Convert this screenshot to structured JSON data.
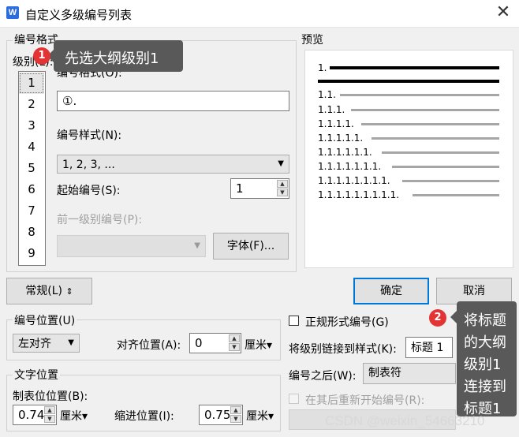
{
  "window": {
    "app_icon_letter": "W",
    "title": "自定义多级编号列表",
    "close_glyph": "✕"
  },
  "format_group": {
    "legend": "编号格式",
    "level_label": "级别(L):",
    "levels": [
      "1",
      "2",
      "3",
      "4",
      "5",
      "6",
      "7",
      "8",
      "9"
    ],
    "selected_level": "1",
    "number_format_label": "编号格式(O):",
    "number_format_value": "①.",
    "number_style_label": "编号样式(N):",
    "number_style_value": "1, 2, 3, ...",
    "start_at_label": "起始编号(S):",
    "start_at_value": "1",
    "prev_level_label": "前一级别编号(P):",
    "font_button": "字体(F)..."
  },
  "preview": {
    "legend": "预览",
    "rows": [
      "1.",
      "1.1.",
      "1.1.1.",
      "1.1.1.1.",
      "1.1.1.1.1.",
      "1.1.1.1.1.1.",
      "1.1.1.1.1.1.1.",
      "1.1.1.1.1.1.1.1.",
      "1.1.1.1.1.1.1.1.1."
    ]
  },
  "buttons": {
    "normal": "常规(L)",
    "normal_icon": "⇕",
    "ok": "确定",
    "cancel": "取消"
  },
  "number_position": {
    "legend": "编号位置(U)",
    "alignment_value": "左对齐",
    "align_at_label": "对齐位置(A):",
    "align_at_value": "0",
    "unit": "厘米"
  },
  "text_position": {
    "legend": "文字位置",
    "tab_pos_label": "制表位位置(B):",
    "tab_pos_value": "0.74",
    "indent_label": "缩进位置(I):",
    "indent_value": "0.75",
    "unit": "厘米"
  },
  "right_options": {
    "legal_style_label": "正规形式编号(G)",
    "link_style_label": "将级别链接到样式(K):",
    "link_style_value": "标题 1",
    "follow_with_label": "编号之后(W):",
    "follow_with_value": "制表符",
    "restart_label": "在其后重新开始编号(R):"
  },
  "annotations": {
    "badge1": "1",
    "tip1": "先选大纲级别1",
    "badge2": "2",
    "tip2_lines": [
      "将标题",
      "的大纲",
      "级别1",
      "连接到",
      "标题1"
    ]
  },
  "watermark": "CSDN @weixin_54663210",
  "colors": {
    "accent": "#0078d7",
    "badge": "#e23434",
    "tooltip": "#595959"
  }
}
